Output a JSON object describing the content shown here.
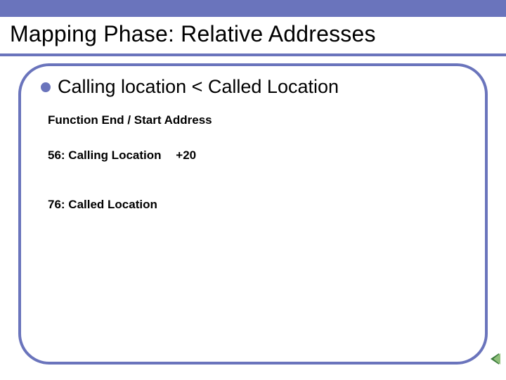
{
  "title": "Mapping Phase: Relative Addresses",
  "bullet": "Calling location < Called Location",
  "sub_header": "Function End / Start Address",
  "calling_row_label": "56: Calling Location",
  "calling_row_offset": "+20",
  "called_row_label": "76: Called Location"
}
